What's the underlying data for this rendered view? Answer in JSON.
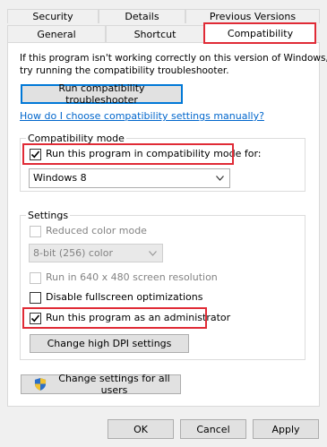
{
  "tabs": {
    "row1": [
      "Security",
      "Details",
      "Previous Versions"
    ],
    "row2": [
      "General",
      "Shortcut",
      "Compatibility"
    ]
  },
  "intro": {
    "line1": "If this program isn't working correctly on this version of Windows,",
    "line2": "try running the compatibility troubleshooter."
  },
  "troubleshooter_button": "Run compatibility troubleshooter",
  "help_link": "How do I choose compatibility settings manually?",
  "compat_mode": {
    "legend": "Compatibility mode",
    "checkbox_label": "Run this program in compatibility mode for:",
    "checked": true,
    "selected_os": "Windows 8"
  },
  "settings": {
    "legend": "Settings",
    "reduced_color": {
      "label": "Reduced color mode",
      "checked": false,
      "disabled": true
    },
    "color_select": "8-bit (256) color",
    "run_640": {
      "label": "Run in 640 x 480 screen resolution",
      "checked": false,
      "disabled": true
    },
    "disable_fullscreen": {
      "label": "Disable fullscreen optimizations",
      "checked": false
    },
    "run_admin": {
      "label": "Run this program as an administrator",
      "checked": true
    },
    "dpi_button": "Change high DPI settings"
  },
  "all_users_button": "Change settings for all users",
  "footer": {
    "ok": "OK",
    "cancel": "Cancel",
    "apply": "Apply"
  },
  "colors": {
    "highlight": "#e02b36",
    "link": "#0066cc",
    "default_button_border": "#0078d7"
  },
  "icons": {
    "shield": "uac-shield-icon",
    "caret": "chevron-down-icon",
    "check": "check-icon"
  }
}
